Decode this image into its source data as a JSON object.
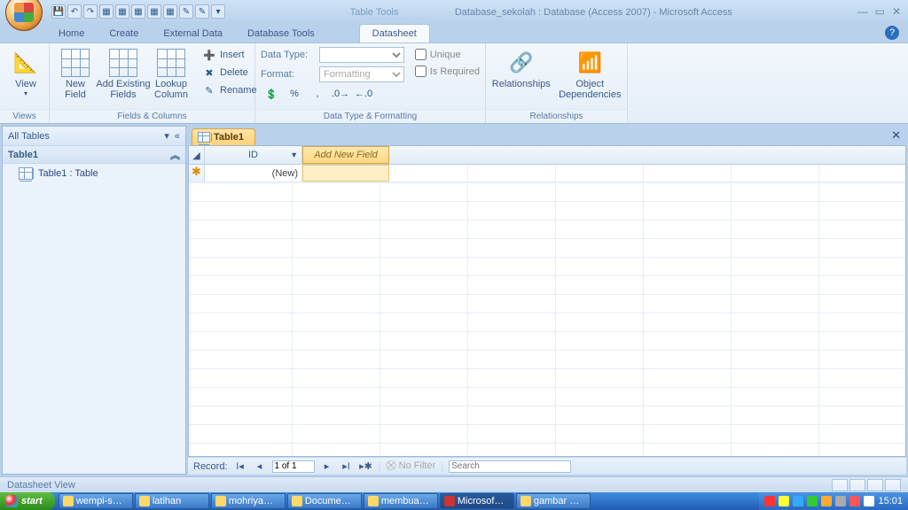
{
  "title": {
    "context": "Table Tools",
    "text": "Database_sekolah : Database (Access 2007) - Microsoft Access"
  },
  "tabs": {
    "home": "Home",
    "create": "Create",
    "external": "External Data",
    "dbtools": "Database Tools",
    "datasheet": "Datasheet"
  },
  "ribbon": {
    "views": {
      "label": "Views",
      "view": "View"
    },
    "fields": {
      "label": "Fields & Columns",
      "newfield": "New\nField",
      "addexisting": "Add Existing\nFields",
      "lookup": "Lookup\nColumn",
      "insert": "Insert",
      "delete": "Delete",
      "rename": "Rename"
    },
    "typefmt": {
      "label": "Data Type & Formatting",
      "datatype": "Data Type:",
      "format": "Format:",
      "format_ph": "Formatting",
      "unique": "Unique",
      "required": "Is Required"
    },
    "relations": {
      "label": "Relationships",
      "rel": "Relationships",
      "dep": "Object\nDependencies"
    }
  },
  "nav": {
    "header": "All Tables",
    "group": "Table1",
    "item": "Table1 : Table"
  },
  "doc": {
    "tab": "Table1",
    "col_id": "ID",
    "col_add": "Add New Field",
    "new": "(New)"
  },
  "recnav": {
    "label": "Record:",
    "pos": "1 of 1",
    "nofilter": "No Filter",
    "search": "Search"
  },
  "status": {
    "view": "Datasheet View"
  },
  "taskbar": {
    "start": "start",
    "items": [
      "wempi-s…",
      "latihan",
      "mohriya…",
      "Docume…",
      "membua…",
      "Microsof…",
      "gambar …"
    ],
    "clock": "15:01"
  }
}
